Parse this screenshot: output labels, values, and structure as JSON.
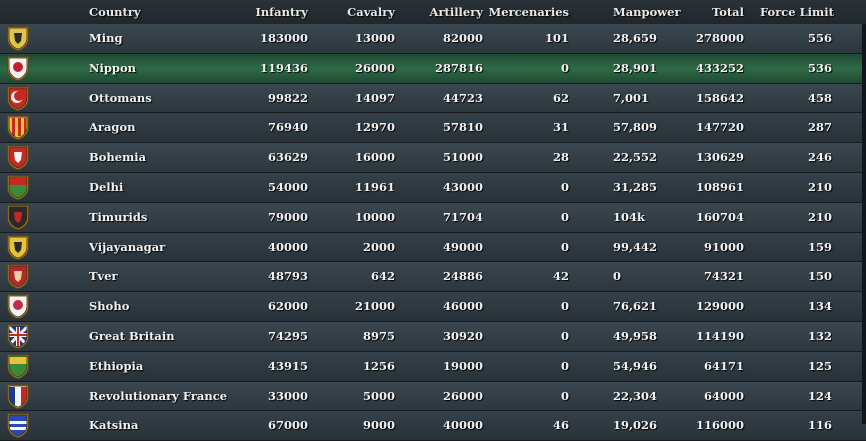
{
  "headers": {
    "country": "Country",
    "infantry": "Infantry",
    "cavalry": "Cavalry",
    "artillery": "Artillery",
    "mercenaries": "Mercenaries",
    "manpower": "Manpower",
    "total": "Total",
    "force_limit": "Force Limit"
  },
  "highlighted_row": 1,
  "rows": [
    {
      "country": "Ming",
      "infantry": "183000",
      "cavalry": "13000",
      "artillery": "82000",
      "mercenaries": "101",
      "manpower": "28,659",
      "total": "278000",
      "force_limit": "556",
      "flag": {
        "name": "ming-flag-icon",
        "bg": "#e0c44a",
        "fg": "#2a2a2a",
        "pattern": "emblem"
      }
    },
    {
      "country": "Nippon",
      "infantry": "119436",
      "cavalry": "26000",
      "artillery": "287816",
      "mercenaries": "0",
      "manpower": "28,901",
      "total": "433252",
      "force_limit": "536",
      "flag": {
        "name": "nippon-flag-icon",
        "bg": "#f4f4f4",
        "fg": "#c0202a",
        "pattern": "disc"
      }
    },
    {
      "country": "Ottomans",
      "infantry": "99822",
      "cavalry": "14097",
      "artillery": "44723",
      "mercenaries": "62",
      "manpower": "7,001",
      "total": "158642",
      "force_limit": "458",
      "flag": {
        "name": "ottomans-flag-icon",
        "bg": "#c42a22",
        "fg": "#f4f4f4",
        "pattern": "crescent"
      }
    },
    {
      "country": "Aragon",
      "infantry": "76940",
      "cavalry": "12970",
      "artillery": "57810",
      "mercenaries": "31",
      "manpower": "57,809",
      "total": "147720",
      "force_limit": "287",
      "flag": {
        "name": "aragon-flag-icon",
        "bg": "#e8c23a",
        "fg": "#c42a22",
        "pattern": "stripes"
      }
    },
    {
      "country": "Bohemia",
      "infantry": "63629",
      "cavalry": "16000",
      "artillery": "51000",
      "mercenaries": "28",
      "manpower": "22,552",
      "total": "130629",
      "force_limit": "246",
      "flag": {
        "name": "bohemia-flag-icon",
        "bg": "#c42a22",
        "fg": "#f4f4f4",
        "pattern": "emblem"
      }
    },
    {
      "country": "Delhi",
      "infantry": "54000",
      "cavalry": "11961",
      "artillery": "43000",
      "mercenaries": "0",
      "manpower": "31,285",
      "total": "108961",
      "force_limit": "210",
      "flag": {
        "name": "delhi-flag-icon",
        "bg": "#3a8a3a",
        "fg": "#c42a22",
        "pattern": "band"
      }
    },
    {
      "country": "Timurids",
      "infantry": "79000",
      "cavalry": "10000",
      "artillery": "71704",
      "mercenaries": "0",
      "manpower": "104k",
      "total": "160704",
      "force_limit": "210",
      "flag": {
        "name": "timurids-flag-icon",
        "bg": "#2a2a2a",
        "fg": "#c42a22",
        "pattern": "emblem"
      }
    },
    {
      "country": "Vijayanagar",
      "infantry": "40000",
      "cavalry": "2000",
      "artillery": "49000",
      "mercenaries": "0",
      "manpower": "99,442",
      "total": "91000",
      "force_limit": "159",
      "flag": {
        "name": "vijayanagar-flag-icon",
        "bg": "#e8c23a",
        "fg": "#2a2a2a",
        "pattern": "emblem"
      }
    },
    {
      "country": "Tver",
      "infantry": "48793",
      "cavalry": "642",
      "artillery": "24886",
      "mercenaries": "42",
      "manpower": "0",
      "total": "74321",
      "force_limit": "150",
      "flag": {
        "name": "tver-flag-icon",
        "bg": "#b02a2a",
        "fg": "#e8d0a0",
        "pattern": "emblem"
      }
    },
    {
      "country": "Shoho",
      "infantry": "62000",
      "cavalry": "21000",
      "artillery": "46000",
      "mercenaries": "0",
      "manpower": "76,621",
      "total": "129000",
      "force_limit": "134",
      "flag": {
        "name": "shoho-flag-icon",
        "bg": "#f4f4f4",
        "fg": "#c42a4a",
        "pattern": "disc"
      }
    },
    {
      "country": "Great Britain",
      "infantry": "74295",
      "cavalry": "8975",
      "artillery": "30920",
      "mercenaries": "0",
      "manpower": "49,958",
      "total": "114190",
      "force_limit": "132",
      "flag": {
        "name": "great-britain-flag-icon",
        "bg": "#1e3a8a",
        "fg": "#c42a22",
        "pattern": "union"
      }
    },
    {
      "country": "Ethiopia",
      "infantry": "43915",
      "cavalry": "1256",
      "artillery": "19000",
      "mercenaries": "0",
      "manpower": "54,946",
      "total": "64171",
      "force_limit": "125",
      "flag": {
        "name": "ethiopia-flag-icon",
        "bg": "#3a8a3a",
        "fg": "#e8c23a",
        "pattern": "band"
      }
    },
    {
      "country": "Revolutionary France",
      "infantry": "33000",
      "cavalry": "5000",
      "artillery": "26000",
      "mercenaries": "0",
      "manpower": "22,304",
      "total": "64000",
      "force_limit": "124",
      "flag": {
        "name": "revolutionary-france-flag-icon",
        "bg": "#f4f4f4",
        "fg": "#1e3a8a",
        "pattern": "tricolor"
      }
    },
    {
      "country": "Katsina",
      "infantry": "67000",
      "cavalry": "9000",
      "artillery": "40000",
      "mercenaries": "46",
      "manpower": "19,026",
      "total": "116000",
      "force_limit": "116",
      "flag": {
        "name": "katsina-flag-icon",
        "bg": "#2a4ab0",
        "fg": "#f4f4f4",
        "pattern": "hstripes"
      }
    }
  ]
}
